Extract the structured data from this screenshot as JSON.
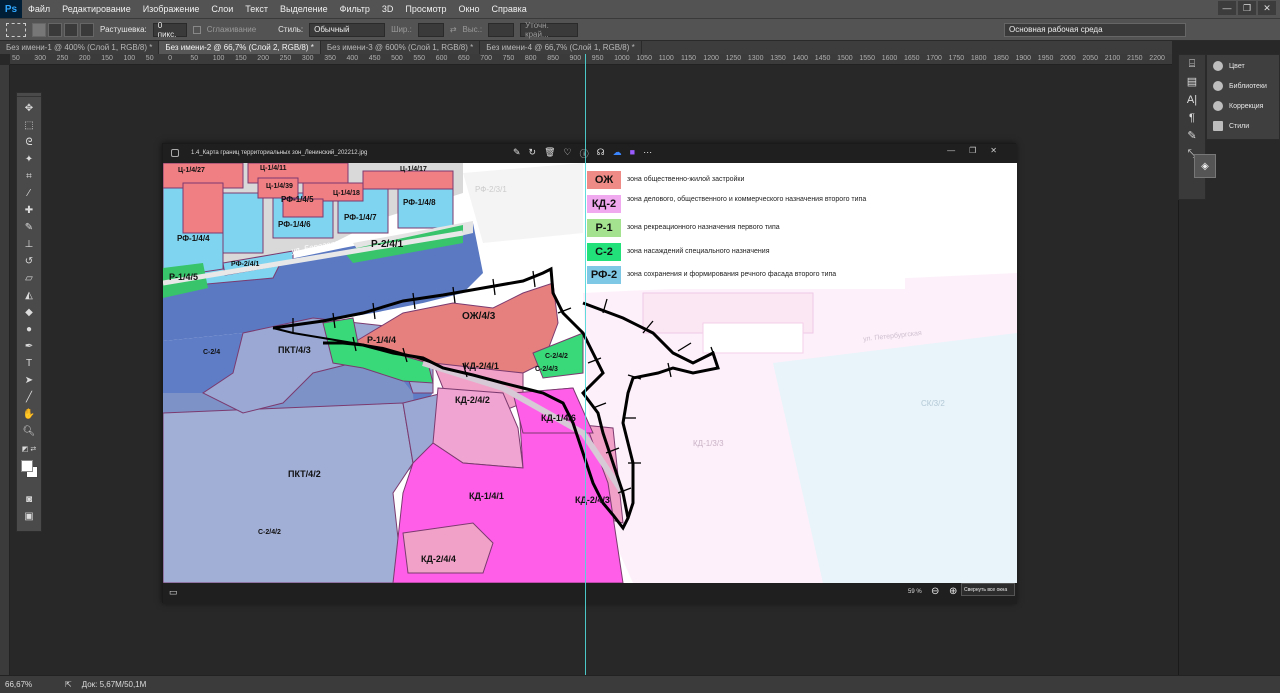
{
  "app": {
    "logo": "Ps",
    "menu": [
      "Файл",
      "Редактирование",
      "Изображение",
      "Слои",
      "Текст",
      "Выделение",
      "Фильтр",
      "3D",
      "Просмотр",
      "Окно",
      "Справка"
    ],
    "window_controls": [
      "—",
      "❐",
      "✕"
    ]
  },
  "options": {
    "feather_label": "Растушевка:",
    "feather_value": "0 пикс.",
    "antialias_label": "Сглаживание",
    "style_label": "Стиль:",
    "style_value": "Обычный",
    "width_label": "Шир.:",
    "height_label": "Выс.:",
    "refine_label": "Уточн. край...",
    "workspace": "Основная рабочая среда"
  },
  "tabs": [
    {
      "label": "Без имени-1 @ 400% (Слой 1, RGB/8) *",
      "active": false
    },
    {
      "label": "Без имени-2 @ 66,7% (Слой 2, RGB/8) *",
      "active": true
    },
    {
      "label": "Без имени-3 @ 600% (Слой 1, RGB/8) *",
      "active": false
    },
    {
      "label": "Без имени-4 @ 66,7% (Слой 1, RGB/8) *",
      "active": false
    }
  ],
  "ruler": [
    "50",
    "300",
    "250",
    "200",
    "150",
    "100",
    "50",
    "0",
    "50",
    "100",
    "150",
    "200",
    "250",
    "300",
    "350",
    "400",
    "450",
    "500",
    "550",
    "600",
    "650",
    "700",
    "750",
    "800",
    "850",
    "900",
    "950",
    "1000",
    "1050",
    "1100",
    "1150",
    "1200",
    "1250",
    "1300",
    "1350",
    "1400",
    "1450",
    "1500",
    "1550",
    "1600",
    "1650",
    "1700",
    "1750",
    "1800",
    "1850",
    "1900",
    "1950",
    "2000",
    "2050",
    "2100",
    "2150",
    "2200"
  ],
  "viewer": {
    "filename": "1.4_Карта границ территориальных зон_Ленинский_202212.jpg",
    "zoom": "59 %",
    "tooltip": "Свернуть все окна"
  },
  "legend": [
    {
      "code": "ОЖ",
      "text": "зона общественно-жилой застройки",
      "color": "#ee8b86"
    },
    {
      "code": "КД-2",
      "text": "зона делового, общественного и коммерческого назначения второго типа",
      "color": "#f0a8ef"
    },
    {
      "code": "Р-1",
      "text": "зона рекреационного назначения первого типа",
      "color": "#a5e28f"
    },
    {
      "code": "С-2",
      "text": "зона насаждений специального назначения",
      "color": "#22e07a"
    },
    {
      "code": "РФ-2",
      "text": "зона сохранения и формирования речного фасада второго типа",
      "color": "#7ec8e6"
    }
  ],
  "map_labels": {
    "oj": "ОЖ/4/3",
    "pkt3": "ПКТ/4/3",
    "pkt2": "ПКТ/4/2",
    "kd242": "КД-2/4/2",
    "kd241": "КД-2/4/1",
    "kd146": "КД-1/4/6",
    "kd141": "КД-1/4/1",
    "kd243": "КД-2/4/3",
    "kd244": "КД-2/4/4",
    "p14": "Р-1/4/4",
    "c2a": "С-2/4",
    "c2b": "С-2/4/2",
    "c2c": "С-2/4/2",
    "rf2": "РФ-2",
    "c24": "С-2/4/3",
    "rf145": "РФ-1/4/5",
    "rf146": "РФ-1/4/6",
    "rf147": "РФ-1/4/7",
    "rf148": "РФ-1/4/8",
    "rf144": "РФ-1/4/4",
    "rf241": "РФ-2/4/1",
    "p241": "Р-2/4/1",
    "p145": "Р-1/4/5",
    "c1427": "Ц-1/4/27",
    "c1411": "Ц-1/4/11",
    "c1417": "Ц-1/4/17",
    "c1418": "Ц-1/4/18",
    "c1439": "Ц-1/4/39",
    "street": "ул. Береговая",
    "kd13": "КД-1/3/3",
    "ck": "СК/3/2",
    "rf3": "РФ-2/3/1",
    "street2": "ул. Петербургская"
  },
  "status": {
    "zoom": "66,67%",
    "doc": "Док: 5,67M/50,1M"
  }
}
